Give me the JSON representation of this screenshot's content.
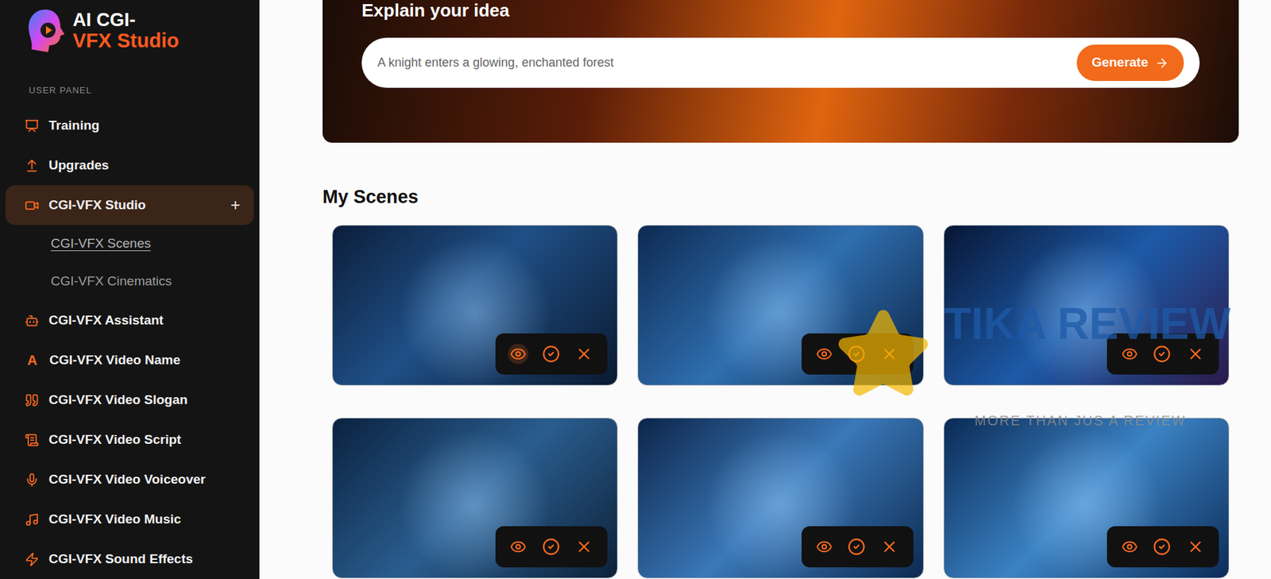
{
  "sidebar": {
    "logo": {
      "line1": "AI CGI-",
      "line2": "VFX Studio"
    },
    "section": "USER PANEL",
    "items": [
      {
        "label": "Training",
        "selected": false
      },
      {
        "label": "Upgrades",
        "selected": false
      },
      {
        "label": "CGI-VFX Studio",
        "selected": true,
        "expanded": true,
        "toggle": "+",
        "children": [
          {
            "label": "CGI-VFX Scenes",
            "selected": true
          },
          {
            "label": "CGI-VFX Cinematics",
            "selected": false
          }
        ]
      },
      {
        "label": "CGI-VFX Assistant",
        "selected": false
      },
      {
        "label": "CGI-VFX Video Name",
        "selected": false,
        "icon_text": "A"
      },
      {
        "label": "CGI-VFX Video Slogan",
        "selected": false
      },
      {
        "label": "CGI-VFX Video Script",
        "selected": false
      },
      {
        "label": "CGI-VFX Video Voiceover",
        "selected": false
      },
      {
        "label": "CGI-VFX Video Music",
        "selected": false
      },
      {
        "label": "CGI-VFX Sound Effects",
        "selected": false
      }
    ]
  },
  "prompt": {
    "title": "Explain your idea",
    "placeholder": "A knight enters a glowing, enchanted forest",
    "button": "Generate"
  },
  "scenes_title": "My Scenes",
  "scenes": [
    {
      "hovered": true
    },
    {
      "hovered": false
    },
    {
      "hovered": false
    },
    {
      "hovered": false
    },
    {
      "hovered": false
    },
    {
      "hovered": false
    }
  ],
  "watermark": {
    "title": "TIKA REVIEW",
    "tagline": "MORE THAN JUS A REVIEW"
  }
}
